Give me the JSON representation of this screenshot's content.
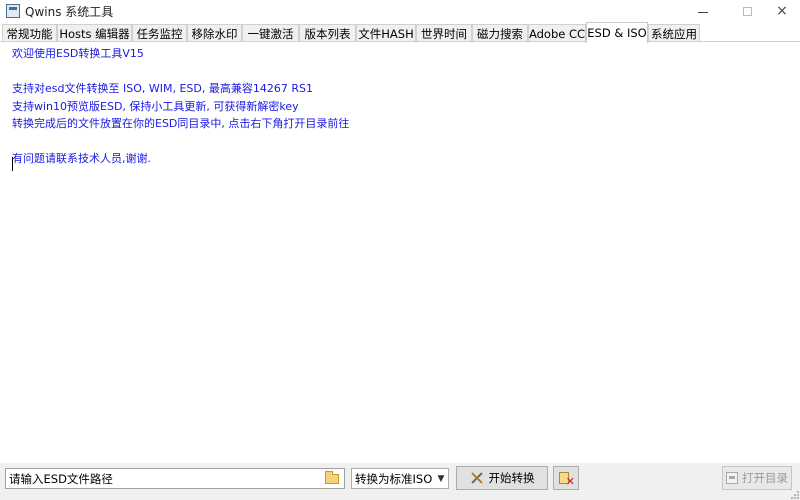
{
  "window": {
    "title": "Qwins 系统工具",
    "app_icon": "app-window-icon",
    "controls": {
      "minimize": "minimize-icon",
      "maximize": "maximize-icon",
      "close": "×"
    }
  },
  "tabs": [
    {
      "label": "常规功能",
      "active": false
    },
    {
      "label": "Hosts 编辑器",
      "active": false
    },
    {
      "label": "任务监控",
      "active": false
    },
    {
      "label": "移除水印",
      "active": false
    },
    {
      "label": "一键激活",
      "active": false
    },
    {
      "label": "版本列表",
      "active": false
    },
    {
      "label": "文件HASH",
      "active": false
    },
    {
      "label": "世界时间",
      "active": false
    },
    {
      "label": "磁力搜索",
      "active": false
    },
    {
      "label": "Adobe CC",
      "active": false
    },
    {
      "label": "ESD & ISO",
      "active": true
    },
    {
      "label": "系统应用",
      "active": false
    }
  ],
  "content": {
    "text_color": "#1919e6",
    "lines": [
      "欢迎使用ESD转换工具V15",
      "",
      "支持对esd文件转换至 ISO, WIM, ESD, 最高兼容14267 RS1",
      "支持win10预览版ESD, 保持小工具更新, 可获得新解密key",
      "转换完成后的文件放置在你的ESD同目录中, 点击右下角打开目录前往",
      "",
      "有问题请联系技术人员,谢谢."
    ]
  },
  "bottom": {
    "path_input_value": "请输入ESD文件路径",
    "browse_icon": "folder-icon",
    "format_selected": "转换为标准ISO",
    "convert_label": "开始转换",
    "convert_icon": "tools-icon",
    "clear_icon": "clear-icon",
    "open_dir_label": "打开目录",
    "open_dir_icon": "printer-icon"
  }
}
